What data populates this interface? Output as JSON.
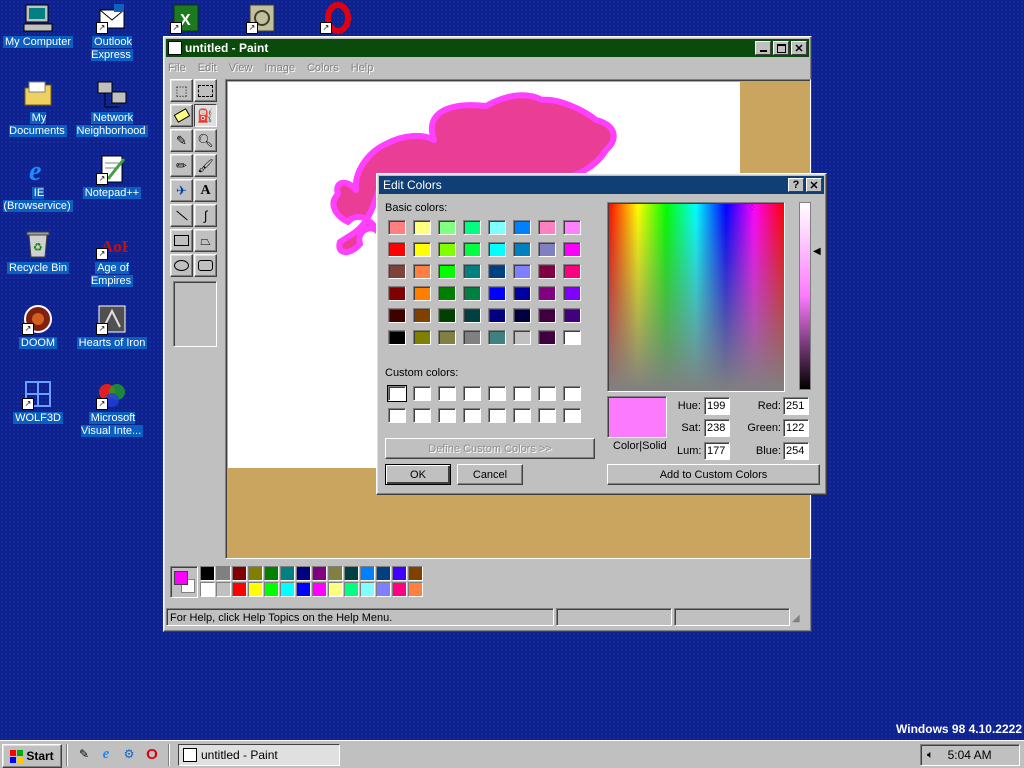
{
  "desktop": {
    "icons": [
      {
        "label": "My Computer"
      },
      {
        "label": "Outlook Express"
      },
      {
        "label": "My Documents"
      },
      {
        "label": "Network Neighborhood"
      },
      {
        "label": "IE (Browservice)"
      },
      {
        "label": "Notepad++"
      },
      {
        "label": "Recycle Bin"
      },
      {
        "label": "Age of Empires"
      },
      {
        "label": "DOOM"
      },
      {
        "label": "Hearts of Iron"
      },
      {
        "label": "WOLF3D"
      },
      {
        "label": "Microsoft Visual Inte..."
      }
    ],
    "os_version": "Windows 98 4.10.2222"
  },
  "paint": {
    "title": "untitled - Paint",
    "menu": [
      "File",
      "Edit",
      "View",
      "Image",
      "Colors",
      "Help"
    ],
    "status": "For Help, click Help Topics on the Help Menu.",
    "palette_colors": [
      "#000000",
      "#808080",
      "#800000",
      "#808000",
      "#008000",
      "#008080",
      "#000080",
      "#800080",
      "#808040",
      "#004040",
      "#0080ff",
      "#004080",
      "#4000ff",
      "#804000",
      "#ffffff",
      "#c0c0c0",
      "#ff0000",
      "#ffff00",
      "#00ff00",
      "#00ffff",
      "#0000ff",
      "#ff00ff",
      "#ffff80",
      "#00ff80",
      "#80ffff",
      "#8080ff",
      "#ff0080",
      "#ff8040"
    ],
    "foreground": "#ff00ff",
    "background": "#ffffff",
    "canvas_bg": "#ffffff",
    "workspace_color": "#c9a560",
    "stroke_color": "#ff40ff",
    "fill_color": "#ea3d95"
  },
  "dialog": {
    "title": "Edit Colors",
    "basic_label": "Basic colors:",
    "custom_label": "Custom colors:",
    "basic_colors": [
      "#ff8080",
      "#ffff80",
      "#80ff80",
      "#00ff80",
      "#80ffff",
      "#0080ff",
      "#ff80c0",
      "#ff80ff",
      "#ff0000",
      "#ffff00",
      "#80ff00",
      "#00ff40",
      "#00ffff",
      "#0080c0",
      "#8080c0",
      "#ff00ff",
      "#804040",
      "#ff8040",
      "#00ff00",
      "#008080",
      "#004080",
      "#8080ff",
      "#800040",
      "#ff0080",
      "#800000",
      "#ff8000",
      "#008000",
      "#008040",
      "#0000ff",
      "#0000a0",
      "#800080",
      "#8000ff",
      "#400000",
      "#804000",
      "#004000",
      "#004040",
      "#000080",
      "#000040",
      "#400040",
      "#400080",
      "#000000",
      "#808000",
      "#808040",
      "#808080",
      "#408080",
      "#c0c0c0",
      "#400040",
      "#ffffff"
    ],
    "define_button": "Define Custom Colors >>",
    "ok_button": "OK",
    "cancel_button": "Cancel",
    "color_solid_label": "Color|Solid",
    "current_color": "#fb7afe",
    "hue_label": "Hue:",
    "hue": "199",
    "sat_label": "Sat:",
    "sat": "238",
    "lum_label": "Lum:",
    "lum": "177",
    "red_label": "Red:",
    "red": "251",
    "green_label": "Green:",
    "green": "122",
    "blue_label": "Blue:",
    "blue": "254",
    "add_button": "Add to Custom Colors"
  },
  "taskbar": {
    "start_label": "Start",
    "task_label": "untitled - Paint",
    "clock": "5:04 AM"
  }
}
